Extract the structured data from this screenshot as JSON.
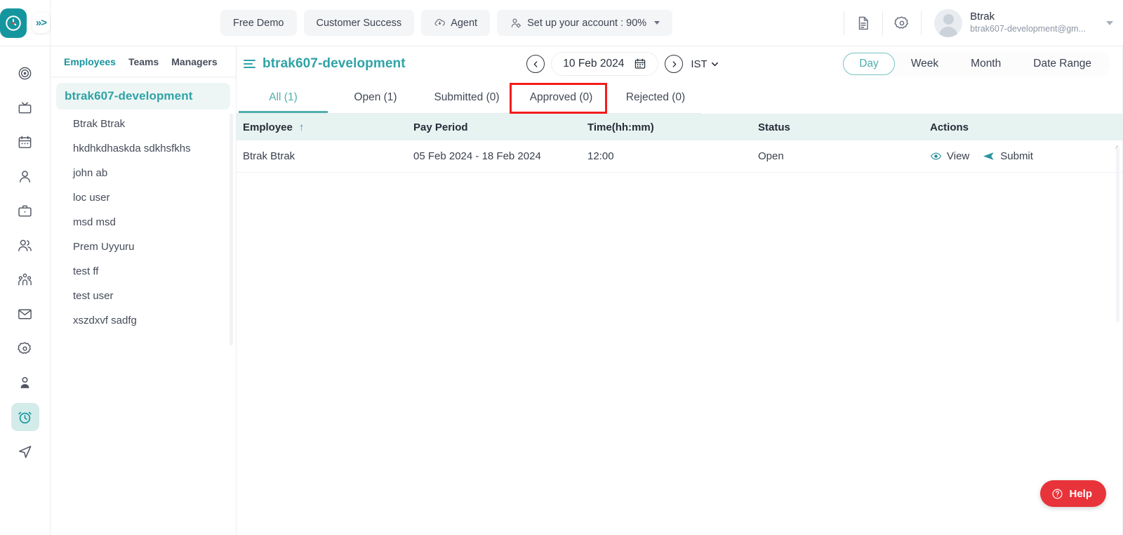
{
  "topbar": {
    "logo_icon": "clock-logo-icon",
    "expand_icon": "chevrons-right-icon",
    "center_buttons": [
      {
        "label": "Free Demo",
        "icon": null
      },
      {
        "label": "Customer Success",
        "icon": null
      },
      {
        "label": "Agent",
        "icon": "cloud-download-icon"
      },
      {
        "label": "Set up your account : 90%",
        "icon": "user-settings-icon",
        "has_caret": true
      }
    ],
    "right_icons": [
      {
        "name": "document-icon"
      },
      {
        "name": "gear-icon"
      }
    ],
    "profile": {
      "name": "Btrak",
      "email": "btrak607-development@gm...",
      "avatar_icon": "avatar-icon",
      "caret_icon": "chevron-down-icon"
    }
  },
  "rail": {
    "items": [
      {
        "icon": "target-icon",
        "active": false
      },
      {
        "icon": "tv-icon",
        "active": false
      },
      {
        "icon": "calendar-icon",
        "active": false
      },
      {
        "icon": "user-icon",
        "active": false
      },
      {
        "icon": "briefcase-icon",
        "active": false
      },
      {
        "icon": "users-icon",
        "active": false
      },
      {
        "icon": "group-people-icon",
        "active": false
      },
      {
        "icon": "mail-icon",
        "active": false
      },
      {
        "icon": "settings-gear-icon",
        "active": false
      },
      {
        "icon": "person-badge-icon",
        "active": false
      },
      {
        "icon": "alarm-clock-icon",
        "active": true
      },
      {
        "icon": "send-navigation-icon",
        "active": false
      }
    ]
  },
  "employee_panel": {
    "tabs": [
      {
        "label": "Employees",
        "active": true
      },
      {
        "label": "Teams",
        "active": false
      },
      {
        "label": "Managers",
        "active": false
      }
    ],
    "group_header": "btrak607-development",
    "employees": [
      "Btrak Btrak",
      "hkdhkdhaskda sdkhsfkhs",
      "john ab",
      "loc user",
      "msd msd",
      "Prem Uyyuru",
      "test ff",
      "test user",
      "xszdxvf sadfg"
    ]
  },
  "main": {
    "menu_icon": "hamburger-icon",
    "project_title": "btrak607-development",
    "date_nav": {
      "prev_icon": "chevron-left-circle-icon",
      "next_icon": "chevron-right-circle-icon",
      "date": "10 Feb 2024",
      "calendar_icon": "calendar-icon",
      "timezone": "IST",
      "timezone_caret": "chevron-down-icon"
    },
    "range_segments": [
      {
        "label": "Day",
        "active": true
      },
      {
        "label": "Week",
        "active": false
      },
      {
        "label": "Month",
        "active": false
      },
      {
        "label": "Date Range",
        "active": false
      }
    ],
    "tabs": [
      {
        "label": "All (1)",
        "active": true,
        "highlighted": false
      },
      {
        "label": "Open (1)",
        "active": false,
        "highlighted": false
      },
      {
        "label": "Submitted (0)",
        "active": false,
        "highlighted": false
      },
      {
        "label": "Approved (0)",
        "active": false,
        "highlighted": true
      },
      {
        "label": "Rejected (0)",
        "active": false,
        "highlighted": false
      }
    ],
    "highlight_color": "#f41c1c",
    "table": {
      "columns": [
        "Employee",
        "Pay Period",
        "Time(hh:mm)",
        "Status",
        "Actions"
      ],
      "sort_column": "Employee",
      "sort_icon": "arrow-up-icon",
      "rows": [
        {
          "employee": "Btrak Btrak",
          "pay_period": "05 Feb 2024 - 18 Feb 2024",
          "time": "12:00",
          "status": "Open",
          "actions": [
            {
              "label": "View",
              "icon": "eye-icon"
            },
            {
              "label": "Submit",
              "icon": "send-icon"
            }
          ]
        }
      ]
    }
  },
  "help": {
    "label": "Help",
    "icon": "question-circle-icon",
    "color": "#e8333a"
  },
  "theme": {
    "accent": "#2fa3a6",
    "accent_light": "#4fb0ae",
    "logo_bg": "#15969e",
    "table_header_bg": "#e7f3f1"
  }
}
